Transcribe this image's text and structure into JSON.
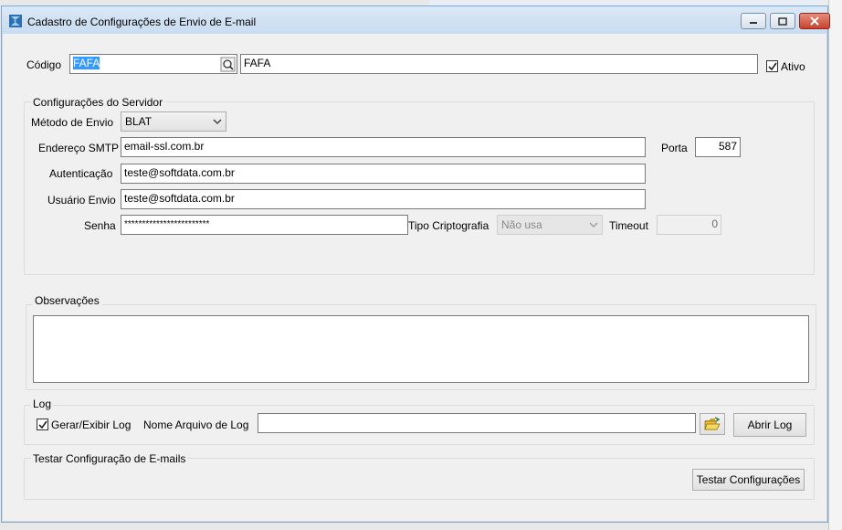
{
  "window": {
    "title": "Cadastro de Configurações de Envio de E-mail"
  },
  "header": {
    "codigo_label": "Código",
    "codigo_value": "FAFA",
    "descricao_value": "FAFA",
    "ativo_label": "Ativo",
    "ativo_checked": true
  },
  "server": {
    "group_title": "Configurações do Servidor",
    "metodo_label": "Método de Envio",
    "metodo_value": "BLAT",
    "smtp_label": "Endereço SMTP",
    "smtp_value": "email-ssl.com.br",
    "porta_label": "Porta",
    "porta_value": "587",
    "autenticacao_label": "Autenticação",
    "autenticacao_value": "teste@softdata.com.br",
    "usuario_label": "Usuário Envio",
    "usuario_value": "teste@softdata.com.br",
    "senha_label": "Senha",
    "senha_value": "************************",
    "cripto_label": "Tipo Criptografia",
    "cripto_value": "Não usa",
    "timeout_label": "Timeout",
    "timeout_value": "0"
  },
  "observacoes": {
    "group_title": "Observações",
    "value": ""
  },
  "log": {
    "group_title": "Log",
    "gerar_label": "Gerar/Exibir Log",
    "gerar_checked": true,
    "arquivo_label": "Nome Arquivo de Log",
    "arquivo_value": "",
    "abrir_button": "Abrir Log"
  },
  "teste": {
    "group_title": "Testar Configuração de E-mails",
    "button": "Testar Configurações"
  },
  "colors": {
    "selection": "#3399ff",
    "titlebar": "#c9dcf0",
    "close": "#c9432c"
  },
  "icons": [
    "app-icon",
    "minimize-icon",
    "maximize-icon",
    "close-icon",
    "search-icon",
    "chevron-down-icon",
    "folder-open-icon",
    "checkmark-icon"
  ]
}
